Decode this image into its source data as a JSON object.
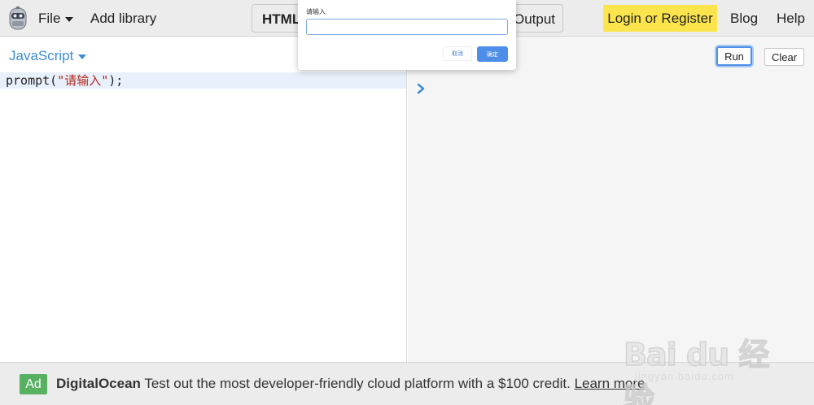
{
  "app": {
    "logo_icon": "jsbin-robot-icon"
  },
  "topbar": {
    "menu": [
      {
        "label": "File",
        "has_caret": true
      },
      {
        "label": "Add library",
        "has_caret": false
      }
    ],
    "tabs": [
      {
        "label": "HTML",
        "active": true
      },
      {
        "label": "Output",
        "active": false
      }
    ],
    "login_label": "Login or Register",
    "links": [
      "Blog",
      "Help"
    ],
    "login_color": "#fbe44c"
  },
  "editor": {
    "language": "JavaScript",
    "code_fn": "prompt(",
    "code_str": "\"请输入\"",
    "code_end": ");"
  },
  "console": {
    "prompt_icon": "chevron-right-icon",
    "run_label": "Run",
    "clear_label": "Clear"
  },
  "dialog": {
    "message": "请输入",
    "input_value": "",
    "cancel_label": "取消",
    "ok_label": "确定",
    "accent": "#4f8ee8"
  },
  "ad": {
    "badge": "Ad",
    "brand": "DigitalOcean",
    "text": " Test out the most developer-friendly cloud platform with a $100 credit. ",
    "link": "Learn more",
    "badge_color": "#58b061"
  },
  "watermark": {
    "logo_text": "Bai du 经验",
    "url": "jingyan.baidu.com"
  }
}
